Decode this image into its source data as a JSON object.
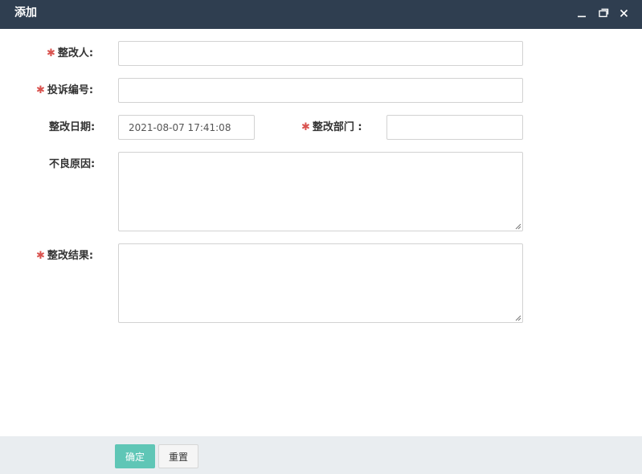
{
  "dialog": {
    "title": "添加"
  },
  "form": {
    "rectifier": {
      "label": "整改人:",
      "required": "✱",
      "value": ""
    },
    "complaint_no": {
      "label": "投诉编号:",
      "required": "✱",
      "value": ""
    },
    "rectify_date": {
      "label": "整改日期:",
      "value": "2021-08-07 17:41:08"
    },
    "rectify_dept": {
      "label": "整改部门 :",
      "required": "✱",
      "value": ""
    },
    "bad_reason": {
      "label": "不良原因:",
      "value": ""
    },
    "rectify_result": {
      "label": "整改结果:",
      "required": "✱",
      "value": ""
    }
  },
  "footer": {
    "confirm_label": "确定",
    "reset_label": "重置"
  },
  "colors": {
    "titlebar": "#2f3e50",
    "required": "#d9534f",
    "confirm": "#5fc6b6",
    "footer_bg": "#e9edf0"
  }
}
